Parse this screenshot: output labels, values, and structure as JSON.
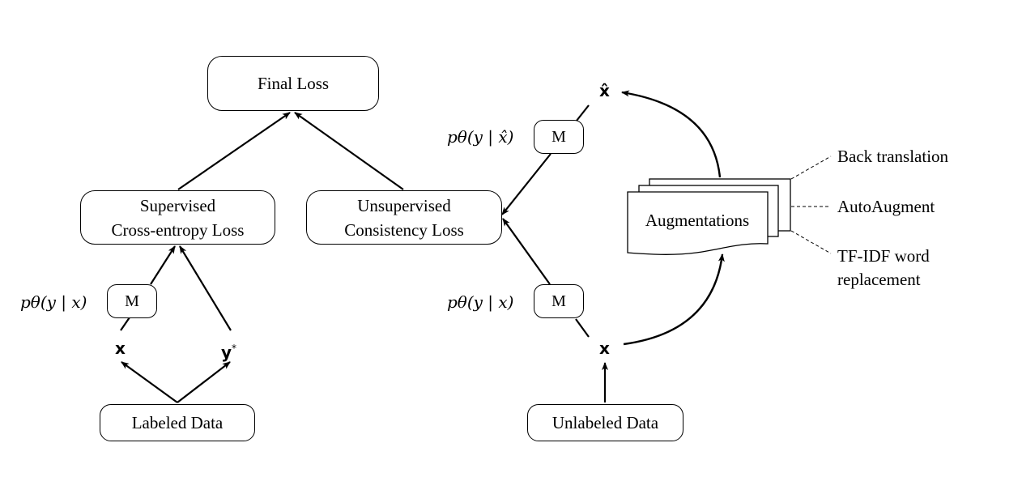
{
  "nodes": {
    "final_loss": "Final Loss",
    "supervised_loss": [
      "Supervised",
      "Cross-entropy Loss"
    ],
    "unsupervised_loss": [
      "Unsupervised",
      "Consistency Loss"
    ],
    "labeled_data": "Labeled Data",
    "unlabeled_data": "Unlabeled Data",
    "model": "M",
    "augmentations": "Augmentations"
  },
  "variables": {
    "x_labeled": "x",
    "y_star": "y",
    "y_star_sup": "*",
    "x_unlabeled": "x",
    "x_hat": "x̂"
  },
  "math_labels": {
    "p_labeled": "pθ(y | x)",
    "p_unlabeled": "pθ(y | x)",
    "p_augmented": "pθ(y | x̂)"
  },
  "augmentation_methods": [
    "Back translation",
    "AutoAugment",
    "TF-IDF word",
    "replacement"
  ]
}
